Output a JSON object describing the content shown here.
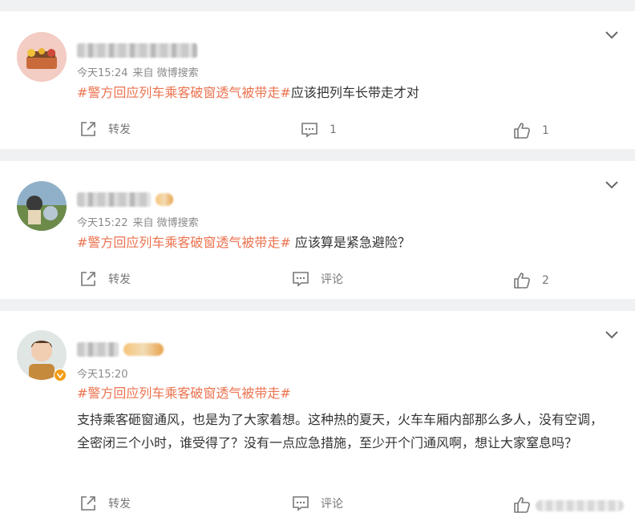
{
  "accent_color": "#eb7350",
  "icons": {
    "expand": "chevron-down-icon",
    "share": "share-icon",
    "comment": "comment-icon",
    "like": "thumbs-up-icon"
  },
  "posts": [
    {
      "time": "今天15:24",
      "source": "来自 微博搜索",
      "topic": "#警方回应列车乘客破窗透气被带走#",
      "text": "应该把列车长带走才对",
      "share_label": "转发",
      "comment_label": "1",
      "like_label": "1"
    },
    {
      "time": "今天15:22",
      "source": "来自 微博搜索",
      "topic": "#警方回应列车乘客破窗透气被带走#",
      "text": " 应该算是紧急避险？",
      "share_label": "转发",
      "comment_label": "评论",
      "like_label": "2"
    },
    {
      "time": "今天15:20",
      "source": "",
      "topic": "#警方回应列车乘客破窗透气被带走#",
      "text": "支持乘客砸窗通风，也是为了大家着想。这种热的夏天，火车车厢内部那么多人，没有空调，全密闭三个小时，谁受得了？没有一点应急措施，至少开个门通风啊，想让大家窒息吗？",
      "share_label": "转发",
      "comment_label": "评论",
      "like_label": ""
    }
  ]
}
